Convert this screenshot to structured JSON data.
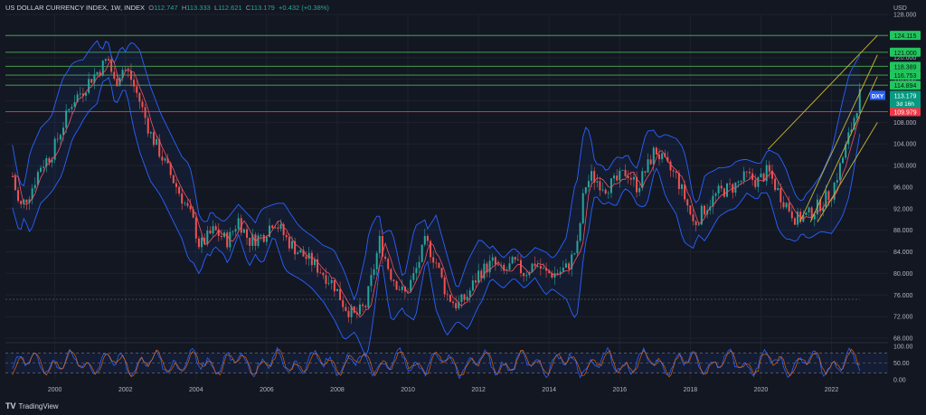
{
  "header": {
    "symbol": "US DOLLAR CURRENCY INDEX, 1W, INDEX",
    "open_label": "O",
    "open": "112.747",
    "high_label": "H",
    "high": "113.333",
    "low_label": "L",
    "low": "112.621",
    "close_label": "C",
    "close": "113.179",
    "change": "+0.432 (+0.38%)"
  },
  "footer": {
    "brand": "TradingView"
  },
  "colors": {
    "background": "#131722",
    "up": "#26a69a",
    "down": "#ef5350",
    "band": "#2962ff",
    "ma": "#f7525f",
    "resistance": "#4caf50",
    "support_red": "#f23645",
    "trend": "#c8b432",
    "text": "#b2b5be"
  },
  "chart_data": {
    "type": "line",
    "price_axis_label": "USD",
    "y_ticks": [
      "128.000",
      "124.000",
      "120.000",
      "116.000",
      "112.000",
      "108.000",
      "104.000",
      "100.000",
      "96.000",
      "92.000",
      "88.000",
      "84.000",
      "80.000",
      "76.000",
      "72.000",
      "68.000"
    ],
    "ylim": [
      68,
      128
    ],
    "x_ticks": [
      "2000",
      "2002",
      "2004",
      "2006",
      "2008",
      "2010",
      "2012",
      "2014",
      "2016",
      "2018",
      "2020",
      "2022"
    ],
    "xlim": [
      1998.6,
      2023.6
    ],
    "series": [
      {
        "x": [
          1998.8,
          1999.0,
          1999.3,
          1999.6,
          1999.9,
          2000.2,
          2000.5,
          2000.8,
          2001.0,
          2001.3,
          2001.5,
          2001.7,
          2001.9,
          2002.1,
          2002.4,
          2002.7,
          2003.0,
          2003.3,
          2003.6,
          2003.9,
          2004.1,
          2004.5,
          2004.9,
          2005.2,
          2005.5,
          2005.9,
          2006.2,
          2006.6,
          2006.9,
          2007.3,
          2007.6,
          2007.9,
          2008.2,
          2008.5,
          2008.8,
          2009.0,
          2009.2,
          2009.5,
          2009.9,
          2010.2,
          2010.5,
          2010.8,
          2011.1,
          2011.4,
          2011.7,
          2012.0,
          2012.4,
          2012.7,
          2013.0,
          2013.3,
          2013.6,
          2013.9,
          2014.2,
          2014.5,
          2014.8,
          2015.0,
          2015.2,
          2015.6,
          2015.9,
          2016.2,
          2016.5,
          2016.8,
          2017.0,
          2017.3,
          2017.6,
          2017.9,
          2018.1,
          2018.4,
          2018.8,
          2019.2,
          2019.6,
          2019.9,
          2020.2,
          2020.5,
          2020.8,
          2021.0,
          2021.4,
          2021.7,
          2022.0,
          2022.3,
          2022.6,
          2022.8
        ],
        "y": [
          98,
          92,
          95,
          100,
          102,
          107,
          112,
          114,
          116,
          118,
          120,
          115,
          118,
          117,
          112,
          106,
          102,
          98,
          94,
          90,
          85,
          88,
          86,
          90,
          86,
          87,
          90,
          86,
          84,
          82,
          80,
          78,
          74,
          72,
          74,
          80,
          86,
          80,
          76,
          80,
          86,
          82,
          76,
          74,
          76,
          80,
          82,
          80,
          82,
          80,
          82,
          80,
          80,
          81,
          85,
          96,
          98,
          96,
          97,
          99,
          96,
          100,
          103,
          100,
          98,
          93,
          89,
          92,
          95,
          96,
          98,
          97,
          99,
          95,
          92,
          90,
          91,
          93,
          95,
          101,
          108,
          113.179
        ]
      }
    ],
    "horizontal_levels": [
      {
        "value": 124.115,
        "label": "124.115"
      },
      {
        "value": 121.0,
        "label": "121.000"
      },
      {
        "value": 118.389,
        "label": "118.389"
      },
      {
        "value": 116.753,
        "label": "116.753"
      },
      {
        "value": 114.894,
        "label": "114.894"
      },
      {
        "value": 109.979,
        "label": "109.979"
      }
    ],
    "last_price": {
      "symbol": "DXY",
      "value": 113.179,
      "label": "113.179",
      "countdown": "3d 16h"
    },
    "dotted_level": 75.2,
    "trend_lines": [
      {
        "x1": 2020.2,
        "y1": 103.0,
        "x2": 2023.3,
        "y2": 124.115
      },
      {
        "x1": 2021.1,
        "y1": 89.5,
        "x2": 2023.3,
        "y2": 120.5
      },
      {
        "x1": 2021.4,
        "y1": 89.5,
        "x2": 2023.3,
        "y2": 116.5
      },
      {
        "x1": 2021.6,
        "y1": 89.5,
        "x2": 2023.3,
        "y2": 108.0
      }
    ],
    "oscillator": {
      "y_ticks": [
        "100.00",
        "50.00",
        "0.00"
      ],
      "ylim": [
        0,
        100
      ],
      "upper_band": 80,
      "lower_band": 20
    }
  }
}
